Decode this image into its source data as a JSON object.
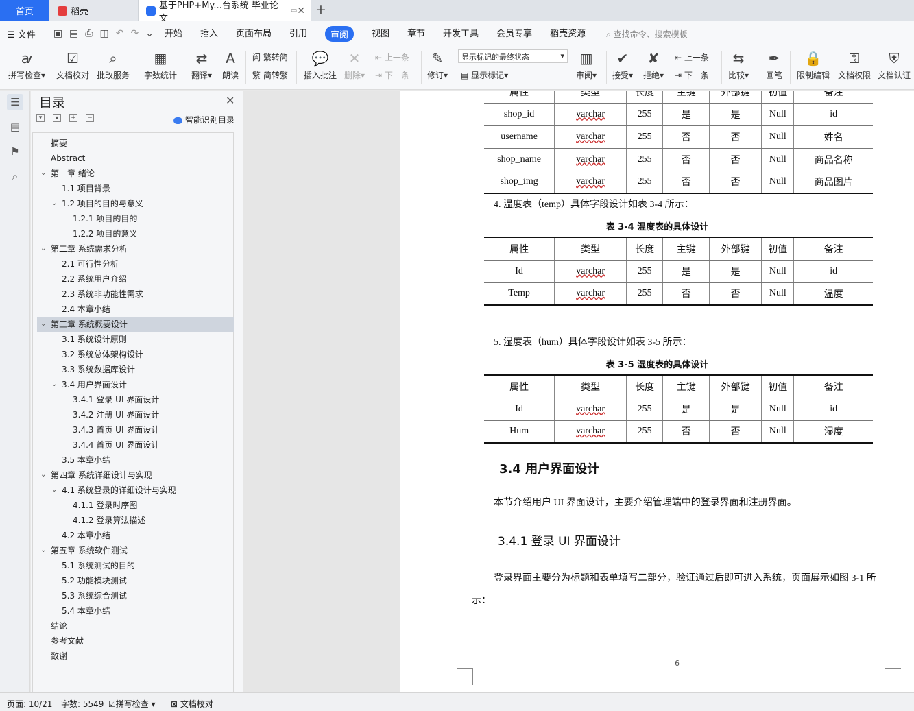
{
  "tabs": {
    "home": "首页",
    "daoke": "稻壳",
    "doc": "基于PHP+My...台系统 毕业论文"
  },
  "menu": {
    "file": "文件",
    "items": [
      "开始",
      "插入",
      "页面布局",
      "引用",
      "审阅",
      "视图",
      "章节",
      "开发工具",
      "会员专享",
      "稻壳资源"
    ],
    "active": "审阅",
    "search": "查找命令、搜索模板"
  },
  "ribbon": {
    "spell": "拼写检查",
    "proof": "文档校对",
    "batch": "批改服务",
    "wordcount": "字数统计",
    "translate": "翻译",
    "read": "朗读",
    "t2s": "繁转简",
    "s2t": "简转繁",
    "insert_comment": "插入批注",
    "delete": "删除",
    "prev": "上一条",
    "next": "下一条",
    "revise": "修订",
    "markstate": "显示标记的最终状态",
    "showmark": "显示标记",
    "review": "审阅",
    "accept": "接受",
    "reject": "拒绝",
    "prev2": "上一条",
    "next2": "下一条",
    "compare": "比较",
    "pen": "画笔",
    "restrict": "限制编辑",
    "docperm": "文档权限",
    "docauth": "文档认证"
  },
  "toc": {
    "title": "目录",
    "smart": "智能识别目录",
    "items": [
      {
        "text": "摘要",
        "level": 0,
        "chev": ""
      },
      {
        "text": "Abstract",
        "level": 0,
        "chev": ""
      },
      {
        "text": "第一章  绪论",
        "level": 0,
        "chev": "down"
      },
      {
        "text": "1.1  项目背景",
        "level": 1,
        "chev": ""
      },
      {
        "text": "1.2  项目的目的与意义",
        "level": 1,
        "chev": "down"
      },
      {
        "text": "1.2.1  项目的目的",
        "level": 2,
        "chev": ""
      },
      {
        "text": "1.2.2  项目的意义",
        "level": 2,
        "chev": ""
      },
      {
        "text": "第二章  系统需求分析",
        "level": 0,
        "chev": "down"
      },
      {
        "text": "2.1  可行性分析",
        "level": 1,
        "chev": ""
      },
      {
        "text": "2.2 系统用户介绍",
        "level": 1,
        "chev": ""
      },
      {
        "text": "2.3  系统非功能性需求",
        "level": 1,
        "chev": ""
      },
      {
        "text": "2.4  本章小结",
        "level": 1,
        "chev": ""
      },
      {
        "text": "第三章  系统概要设计",
        "level": 0,
        "chev": "down",
        "selected": true
      },
      {
        "text": "3.1  系统设计原则",
        "level": 1,
        "chev": ""
      },
      {
        "text": "3.2  系统总体架构设计",
        "level": 1,
        "chev": ""
      },
      {
        "text": "3.3  系统数据库设计",
        "level": 1,
        "chev": ""
      },
      {
        "text": "3.4  用户界面设计",
        "level": 1,
        "chev": "down"
      },
      {
        "text": "3.4.1  登录 UI 界面设计",
        "level": 2,
        "chev": ""
      },
      {
        "text": "3.4.2 注册  UI 界面设计",
        "level": 2,
        "chev": ""
      },
      {
        "text": "3.4.3 首页 UI 界面设计",
        "level": 2,
        "chev": ""
      },
      {
        "text": "3.4.4 首页 UI 界面设计",
        "level": 2,
        "chev": ""
      },
      {
        "text": "3.5  本章小结",
        "level": 1,
        "chev": ""
      },
      {
        "text": "第四章  系统详细设计与实现",
        "level": 0,
        "chev": "down"
      },
      {
        "text": "4.1  系统登录的详细设计与实现",
        "level": 1,
        "chev": "down"
      },
      {
        "text": "4.1.1  登录时序图",
        "level": 2,
        "chev": ""
      },
      {
        "text": "4.1.2  登录算法描述",
        "level": 2,
        "chev": ""
      },
      {
        "text": "4.2  本章小结",
        "level": 1,
        "chev": ""
      },
      {
        "text": "第五章  系统软件测试",
        "level": 0,
        "chev": "down"
      },
      {
        "text": "5.1  系统测试的目的",
        "level": 1,
        "chev": ""
      },
      {
        "text": "5.2  功能模块测试",
        "level": 1,
        "chev": ""
      },
      {
        "text": "5.3  系统综合测试",
        "level": 1,
        "chev": ""
      },
      {
        "text": "5.4  本章小结",
        "level": 1,
        "chev": ""
      },
      {
        "text": "结论",
        "level": 0,
        "chev": ""
      },
      {
        "text": "参考文献",
        "level": 0,
        "chev": ""
      },
      {
        "text": "致谢",
        "level": 0,
        "chev": ""
      }
    ]
  },
  "doc": {
    "table_top": {
      "header_partial": [
        "属性",
        "类型",
        "长度",
        "主键",
        "外部键",
        "初值",
        "备注"
      ],
      "rows": [
        [
          "shop_id",
          "varchar",
          "255",
          "是",
          "是",
          "Null",
          "id"
        ],
        [
          "username",
          "varchar",
          "255",
          "否",
          "否",
          "Null",
          "姓名"
        ],
        [
          "shop_name",
          "varchar",
          "255",
          "否",
          "否",
          "Null",
          "商品名称"
        ],
        [
          "shop_img",
          "varchar",
          "255",
          "否",
          "否",
          "Null",
          "商品图片"
        ]
      ]
    },
    "p_temp": "4. 温度表（temp）具体字段设计如表 3-4 所示：",
    "cap_temp": "表 3-4  温度表的具体设计",
    "table_temp": {
      "header": [
        "属性",
        "类型",
        "长度",
        "主键",
        "外部键",
        "初值",
        "备注"
      ],
      "rows": [
        [
          "Id",
          "varchar",
          "255",
          "是",
          "是",
          "Null",
          "id"
        ],
        [
          "Temp",
          "varchar",
          "255",
          "否",
          "否",
          "Null",
          "温度"
        ]
      ]
    },
    "p_hum": "5. 湿度表（hum）具体字段设计如表 3-5 所示：",
    "cap_hum": "表 3-5  湿度表的具体设计",
    "table_hum": {
      "header": [
        "属性",
        "类型",
        "长度",
        "主键",
        "外部键",
        "初值",
        "备注"
      ],
      "rows": [
        [
          "Id",
          "varchar",
          "255",
          "是",
          "是",
          "Null",
          "id"
        ],
        [
          "Hum",
          "varchar",
          "255",
          "否",
          "否",
          "Null",
          "湿度"
        ]
      ]
    },
    "h2": "3.4  用户界面设计",
    "p_ui": "本节介绍用户 UI 界面设计，主要介绍管理端中的登录界面和注册界面。",
    "h3": "3.4.1  登录 UI 界面设计",
    "p_login1": "登录界面主要分为标题和表单填写二部分，验证通过后即可进入系统，页面展示如图 3-1 所",
    "p_login2": "示：",
    "page_number": "6"
  },
  "status": {
    "page": "页面: 10/21",
    "words": "字数: 5549",
    "spell": "拼写检查",
    "proof": "文档校对"
  }
}
